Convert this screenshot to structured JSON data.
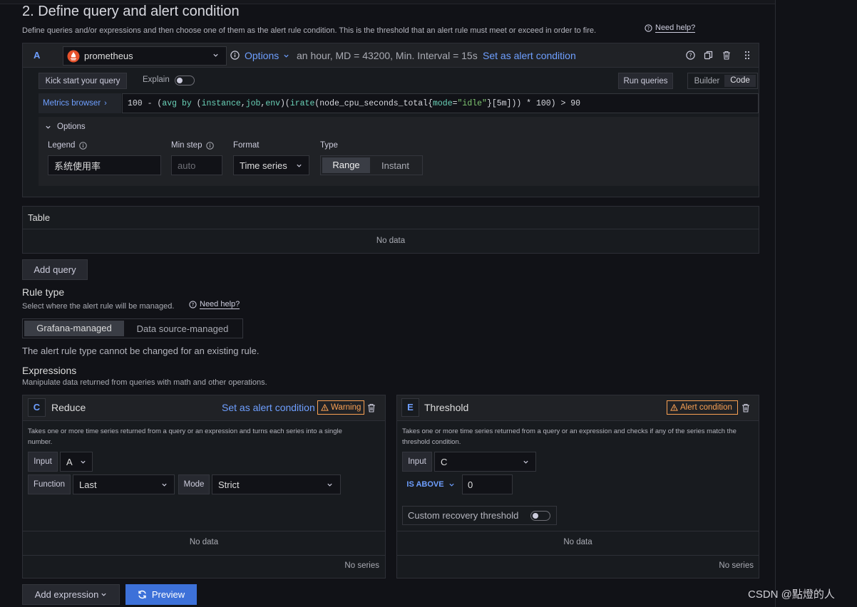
{
  "section": {
    "title": "2. Define query and alert condition",
    "description": "Define queries and/or expressions and then choose one of them as the alert rule condition. This is the threshold that an alert rule must meet or exceed in order to fire.",
    "help_link": "Need help?"
  },
  "query": {
    "ref_id": "A",
    "datasource": "prometheus",
    "options_label": "Options",
    "options_summary": "an hour, MD = 43200, Min. Interval = 15s",
    "set_alert_condition": "Set as alert condition",
    "kick_start": "Kick start your query",
    "explain_label": "Explain",
    "run_queries": "Run queries",
    "builder_label": "Builder",
    "code_label": "Code",
    "metrics_browser": "Metrics browser",
    "expr_tokens": [
      "100 - (",
      "avg",
      " ",
      "by",
      " (",
      "instance",
      ",",
      "job",
      ",",
      "env",
      ")(",
      "irate",
      "(node_cpu_seconds_total{",
      "mode",
      "=",
      "\"idle\"",
      "}[5m])) * 100) > 90"
    ],
    "options": {
      "header": "Options",
      "legend_label": "Legend",
      "legend_value": "系统使用率",
      "min_step_label": "Min step",
      "min_step_placeholder": "auto",
      "format_label": "Format",
      "format_value": "Time series",
      "type_label": "Type",
      "type_range": "Range",
      "type_instant": "Instant"
    }
  },
  "table": {
    "title": "Table",
    "empty": "No data"
  },
  "add_query": "Add query",
  "rule_type": {
    "title": "Rule type",
    "description": "Select where the alert rule will be managed.",
    "help_link": "Need help?",
    "grafana_managed": "Grafana-managed",
    "datasource_managed": "Data source-managed",
    "note": "The alert rule type cannot be changed for an existing rule."
  },
  "expressions": {
    "title": "Expressions",
    "description": "Manipulate data returned from queries with math and other operations.",
    "reduce": {
      "ref_id": "C",
      "name": "Reduce",
      "set_alert_condition": "Set as alert condition",
      "badge": "Warning",
      "description": "Takes one or more time series returned from a query or an expression and turns each series into a single number.",
      "input_label": "Input",
      "input_value": "A",
      "function_label": "Function",
      "function_value": "Last",
      "mode_label": "Mode",
      "mode_value": "Strict",
      "no_data": "No data",
      "no_series": "No series"
    },
    "threshold": {
      "ref_id": "E",
      "name": "Threshold",
      "badge": "Alert condition",
      "description": "Takes one or more time series returned from a query or an expression and checks if any of the series match the threshold condition.",
      "input_label": "Input",
      "input_value": "C",
      "operator": "IS ABOVE",
      "value": "0",
      "custom_recovery": "Custom recovery threshold",
      "no_data": "No data",
      "no_series": "No series"
    }
  },
  "footer": {
    "add_expression": "Add expression",
    "preview": "Preview"
  },
  "watermark": "CSDN @點燈的人",
  "colors": {
    "accent": "#6e9fff",
    "primary_button": "#3d71d9",
    "warning": "#f8a053",
    "prometheus": "#e6522c"
  }
}
